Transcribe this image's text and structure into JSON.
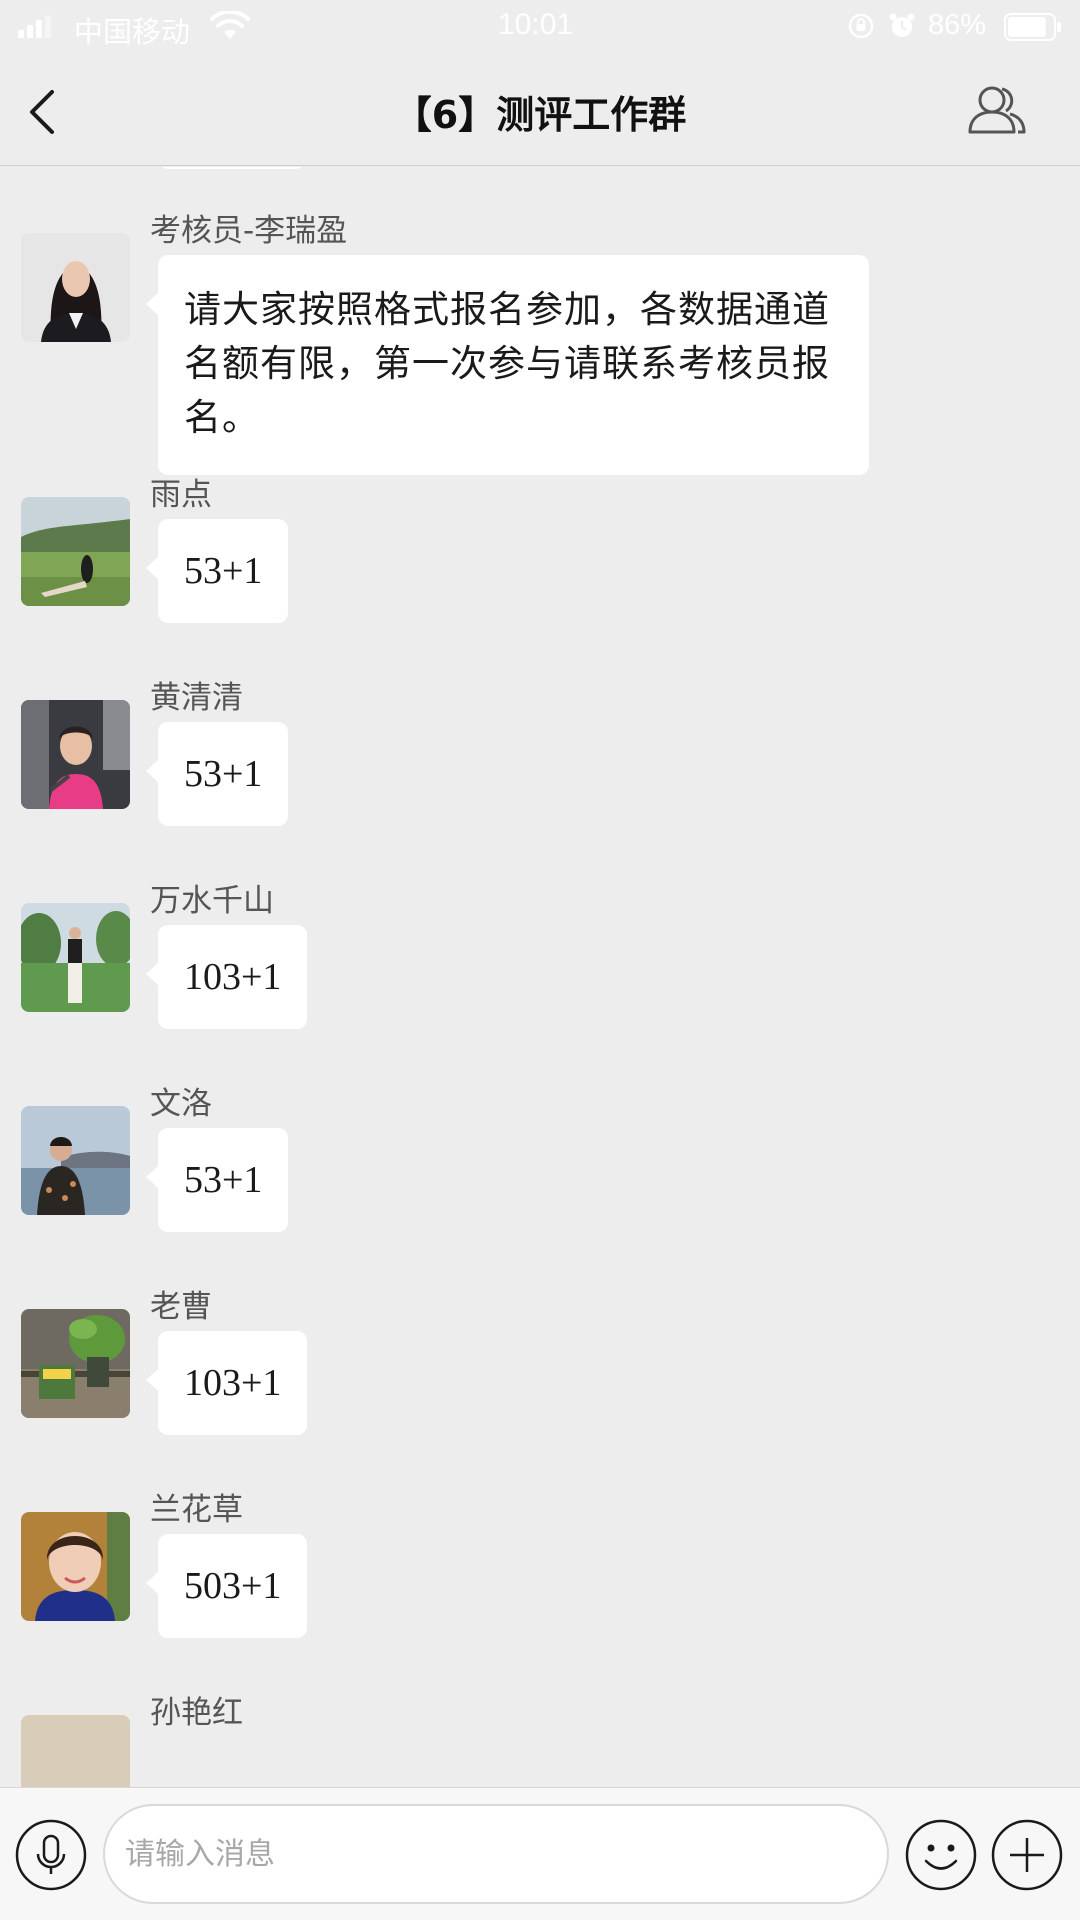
{
  "status_bar": {
    "carrier": "中国移动",
    "time": "10:01",
    "battery_percent": "86%",
    "battery_level": 0.86,
    "icons": [
      "signal-icon",
      "wifi-icon",
      "rotation-lock-icon",
      "alarm-icon",
      "battery-icon"
    ]
  },
  "nav": {
    "title": "【6】测评工作群",
    "icons": [
      "back-icon",
      "group-members-icon"
    ]
  },
  "messages": [
    {
      "sender": "考核员-李瑞盈",
      "text": "请大家按照格式报名参加，各数据通道名额有限，第一次参与请联系考核员报名。",
      "avatar": "woman-portrait-dark-suit"
    },
    {
      "sender": "雨点",
      "text": "53+1",
      "avatar": "woman-on-green-hillside"
    },
    {
      "sender": "黄清清",
      "text": "53+1",
      "avatar": "woman-in-car-pink-shirt"
    },
    {
      "sender": "万水千山",
      "text": "103+1",
      "avatar": "woman-in-park-white-pants"
    },
    {
      "sender": "文洛",
      "text": "53+1",
      "avatar": "woman-by-lake"
    },
    {
      "sender": "老曹",
      "text": "103+1",
      "avatar": "desk-with-potted-plant"
    },
    {
      "sender": "兰花草",
      "text": "503+1",
      "avatar": "woman-face-closeup"
    },
    {
      "sender": "孙艳红",
      "text": "",
      "avatar": "partial-beige"
    }
  ],
  "input_bar": {
    "placeholder": "请输入消息",
    "value": "",
    "icons": [
      "microphone-icon",
      "emoji-icon",
      "plus-icon"
    ]
  },
  "colors": {
    "background": "#ededed",
    "bubble": "#ffffff",
    "sender_text": "#555555",
    "status_text": "#ffffff"
  }
}
